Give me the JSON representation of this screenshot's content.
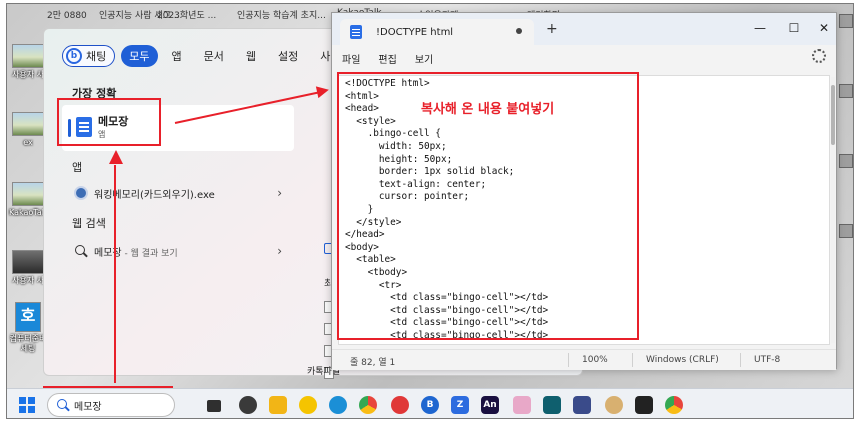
{
  "desktop": {
    "top_labels": [
      "2만 0880",
      "인공지능 사람 세그 ...",
      "2023학년도 ...",
      "인공지능 학습계 초지...",
      "KakaoTalk ...",
      "수업용과제 ...",
      "대기화면..."
    ],
    "icons": [
      {
        "label": "사용자 사",
        "kind": "photo"
      },
      {
        "label": "ex",
        "kind": "photo"
      },
      {
        "label": "KakaoTalk",
        "kind": "photo"
      },
      {
        "label": "사용자 사",
        "kind": "dark"
      },
      {
        "label": "컴퓨터준비 세팅",
        "kind": "blue",
        "glyph": "호"
      }
    ]
  },
  "search_panel": {
    "filters": [
      "채팅",
      "모두",
      "앱",
      "문서",
      "웹",
      "설정",
      "사람"
    ],
    "best_match_heading": "가장 정확",
    "best_match": {
      "title": "메모장",
      "subtitle": "앱"
    },
    "apps_heading": "앱",
    "apps": [
      {
        "label": "워킹메모리(카드외우기).exe"
      }
    ],
    "web_heading": "웹 검색",
    "web_results": [
      {
        "label": "메모장",
        "suffix": " - 웹 결과 보기"
      }
    ],
    "recent_heading": "최근",
    "kakao_file": "카톡파일"
  },
  "notepad": {
    "tab_title": "!DOCTYPE html",
    "menu": [
      "파일",
      "편집",
      "보기"
    ],
    "code": "<!DOCTYPE html>\n<html>\n<head>\n  <style>\n    .bingo-cell {\n      width: 50px;\n      height: 50px;\n      border: 1px solid black;\n      text-align: center;\n      cursor: pointer;\n    }\n  </style>\n</head>\n<body>\n  <table>\n    <tbody>\n      <tr>\n        <td class=\"bingo-cell\"></td>\n        <td class=\"bingo-cell\"></td>\n        <td class=\"bingo-cell\"></td>\n        <td class=\"bingo-cell\"></td>",
    "pasted_note": "복사해 온 내용 붙여넣기",
    "status": {
      "position": "줄 82, 열 1",
      "zoom": "100%",
      "line_ending": "Windows (CRLF)",
      "encoding": "UTF-8"
    }
  },
  "taskbar": {
    "search_value": "메모장",
    "apps": [
      "task-view",
      "settings",
      "file-explorer",
      "media-player",
      "edge",
      "chrome",
      "chrome-record",
      "bluetooth",
      "zoom",
      "animate",
      "gift",
      "reader",
      "remote",
      "pet",
      "sticky",
      "chrome"
    ]
  },
  "colors": {
    "annotation": "#e8202a",
    "accent": "#1f5fd6"
  }
}
